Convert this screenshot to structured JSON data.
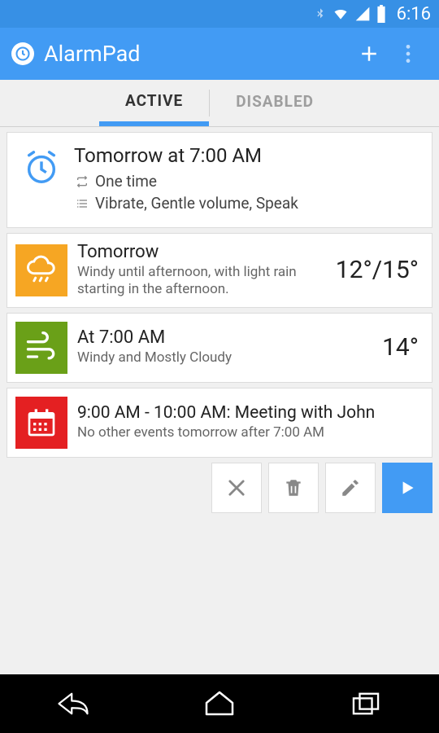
{
  "status": {
    "time": "6:16"
  },
  "app": {
    "title": "AlarmPad"
  },
  "tabs": {
    "active": "ACTIVE",
    "disabled": "DISABLED",
    "selected_index": 0
  },
  "alarm": {
    "title": "Tomorrow at 7:00 AM",
    "repeat": "One time",
    "options": "Vibrate, Gentle volume, Speak"
  },
  "weather_day": {
    "title": "Tomorrow",
    "description": "Windy until afternoon, with light rain starting in the afternoon.",
    "temp": "12°/15°"
  },
  "weather_time": {
    "title": "At 7:00 AM",
    "description": "Windy and Mostly Cloudy",
    "temp": "14°"
  },
  "calendar": {
    "title": "9:00 AM - 10:00 AM: Meeting with John",
    "sub": "No other events tomorrow after 7:00 AM"
  },
  "colors": {
    "primary": "#429bf4",
    "primary_dark": "#3790e5",
    "orange": "#f6a623",
    "green": "#6aa018",
    "red": "#e42022"
  }
}
